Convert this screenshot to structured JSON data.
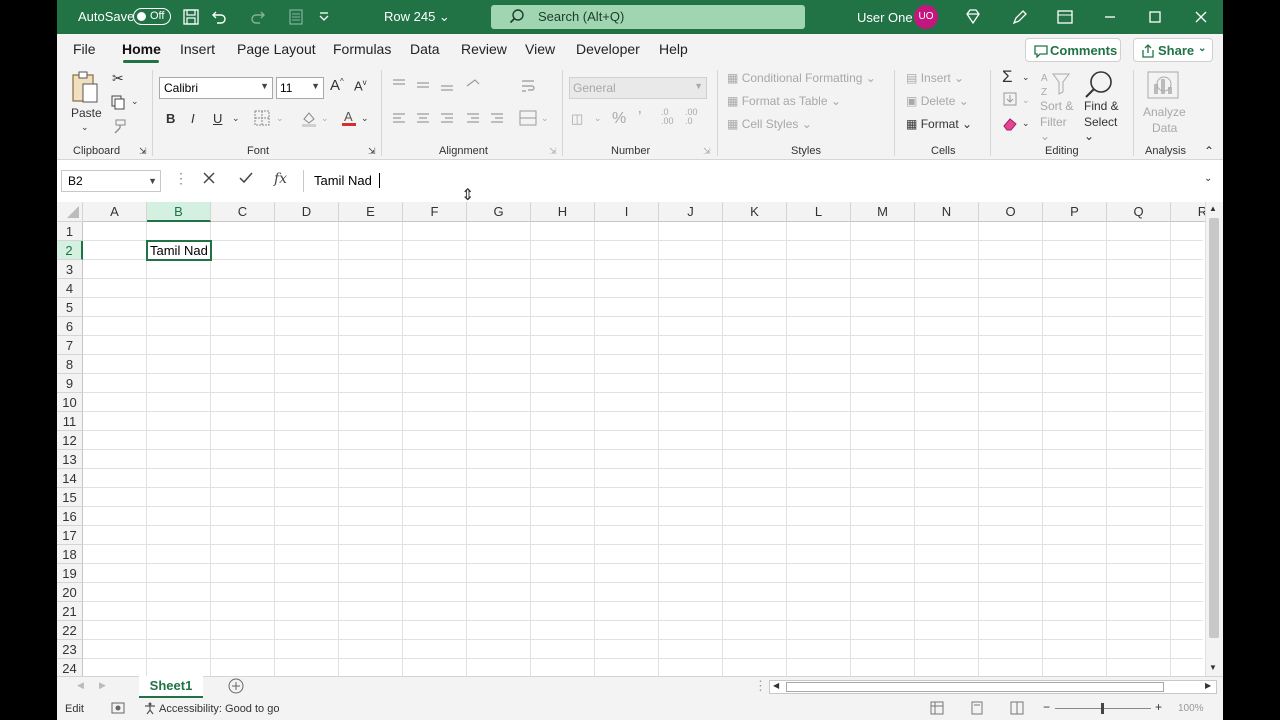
{
  "titlebar": {
    "autosave_label": "AutoSave",
    "autosave_state": "Off",
    "document_name": "Row 245",
    "search_placeholder": "Search (Alt+Q)",
    "user_name": "User One",
    "user_initials": "UO",
    "accent_color": "#217346"
  },
  "tabs": [
    "File",
    "Home",
    "Insert",
    "Page Layout",
    "Formulas",
    "Data",
    "Review",
    "View",
    "Developer",
    "Help"
  ],
  "active_tab": "Home",
  "actions": {
    "comments": "Comments",
    "share": "Share"
  },
  "ribbon": {
    "clipboard": {
      "paste": "Paste",
      "label": "Clipboard"
    },
    "font": {
      "name": "Calibri",
      "size": "11",
      "bold": "B",
      "italic": "I",
      "underline": "U",
      "label": "Font"
    },
    "alignment": {
      "label": "Alignment"
    },
    "number": {
      "format": "General",
      "label": "Number"
    },
    "styles": {
      "conditional": "Conditional Formatting",
      "format_table": "Format as Table",
      "cell_styles": "Cell Styles",
      "label": "Styles"
    },
    "cells": {
      "insert": "Insert",
      "delete": "Delete",
      "format": "Format",
      "label": "Cells"
    },
    "editing": {
      "sort_1": "Sort &",
      "sort_2": "Filter",
      "find_1": "Find &",
      "find_2": "Select",
      "label": "Editing"
    },
    "analysis": {
      "analyze_1": "Analyze",
      "analyze_2": "Data",
      "label": "Analysis"
    }
  },
  "formula_bar": {
    "name_box": "B2",
    "content": "Tamil Nad",
    "fx": "fx"
  },
  "grid": {
    "columns": [
      "A",
      "B",
      "C",
      "D",
      "E",
      "F",
      "G",
      "H",
      "I",
      "J",
      "K",
      "L",
      "M",
      "N",
      "O",
      "P",
      "Q",
      "R"
    ],
    "rows": [
      "1",
      "2",
      "3",
      "4",
      "5",
      "6",
      "7",
      "8",
      "9",
      "10",
      "11",
      "12",
      "13",
      "14",
      "15",
      "16",
      "17",
      "18",
      "19",
      "20",
      "21",
      "22",
      "23",
      "24"
    ],
    "selected_column": "B",
    "selected_row": "2",
    "active_cell_value": "Tamil Nad"
  },
  "sheets": [
    "Sheet1"
  ],
  "status": {
    "mode": "Edit",
    "accessibility": "Accessibility: Good to go",
    "zoom": "100%"
  }
}
